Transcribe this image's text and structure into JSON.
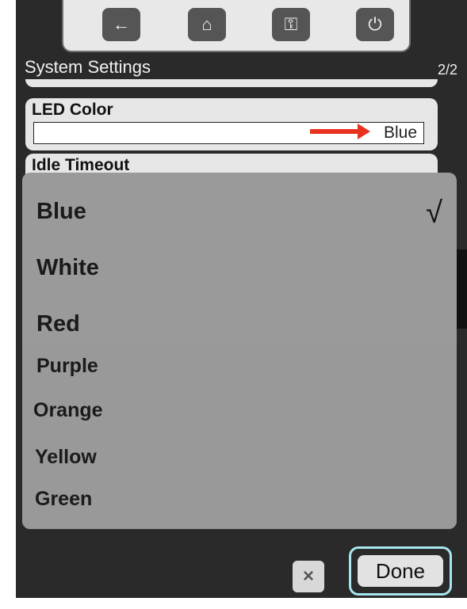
{
  "toolbar": {
    "icons": [
      "back-arrow-icon",
      "home-icon",
      "key-icon",
      "power-icon"
    ]
  },
  "header": {
    "title": "System Settings",
    "page": "2/2"
  },
  "settings": {
    "led": {
      "label": "LED Color",
      "value": "Blue"
    },
    "idle": {
      "label": "Idle Timeout"
    }
  },
  "dropdown": {
    "options": [
      "Blue",
      "White",
      "Red",
      "Purple",
      "Orange",
      "Yellow",
      "Green"
    ],
    "selected": "Blue",
    "check": "√"
  },
  "footer": {
    "cancel_icon": "×",
    "done_label": "Done"
  },
  "colors": {
    "highlight": "#a8e6f0",
    "arrow": "#e8321e"
  }
}
